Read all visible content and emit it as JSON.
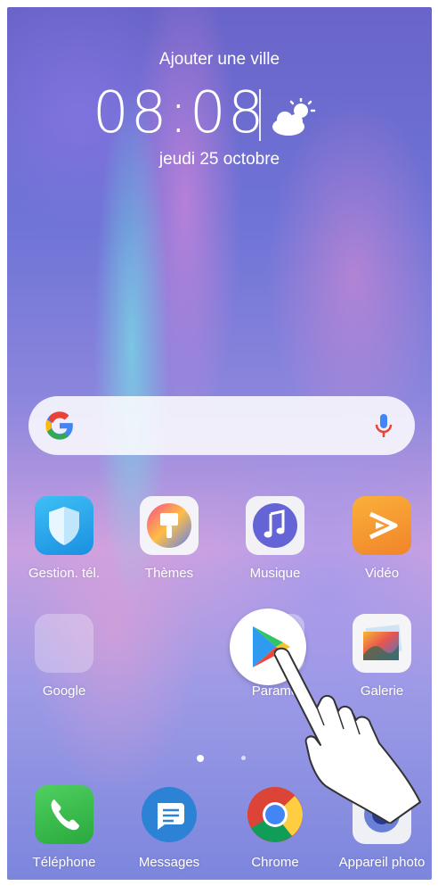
{
  "lockscreen": {
    "city": "Ajouter une ville",
    "time": "08:08",
    "date": "jeudi 25 octobre",
    "weather_icon": "partly-cloudy-icon"
  },
  "search": {
    "logo": "google-g-icon",
    "mic_icon": "microphone-icon"
  },
  "apps_row1": [
    {
      "label": "Gestion. tél.",
      "icon": "shield-icon"
    },
    {
      "label": "Thèmes",
      "icon": "paintbrush-icon"
    },
    {
      "label": "Musique",
      "icon": "music-note-icon"
    },
    {
      "label": "Vidéo",
      "icon": "play-icon"
    }
  ],
  "apps_row2": [
    {
      "label": "Google",
      "icon": "folder-icon"
    },
    {
      "label": "Parame",
      "icon": "play-store-icon"
    },
    {
      "label": "Galerie",
      "icon": "photos-icon"
    }
  ],
  "dock": [
    {
      "label": "Téléphone",
      "icon": "phone-icon"
    },
    {
      "label": "Messages",
      "icon": "message-icon"
    },
    {
      "label": "Chrome",
      "icon": "chrome-icon"
    },
    {
      "label": "Appareil photo",
      "icon": "camera-icon"
    }
  ],
  "page_indicator": {
    "pages": 2,
    "current": 1
  },
  "colors": {
    "shield": "#1da1e8",
    "video": "#f39a2b",
    "phone": "#35c24a",
    "messages": "#2c83d6"
  }
}
